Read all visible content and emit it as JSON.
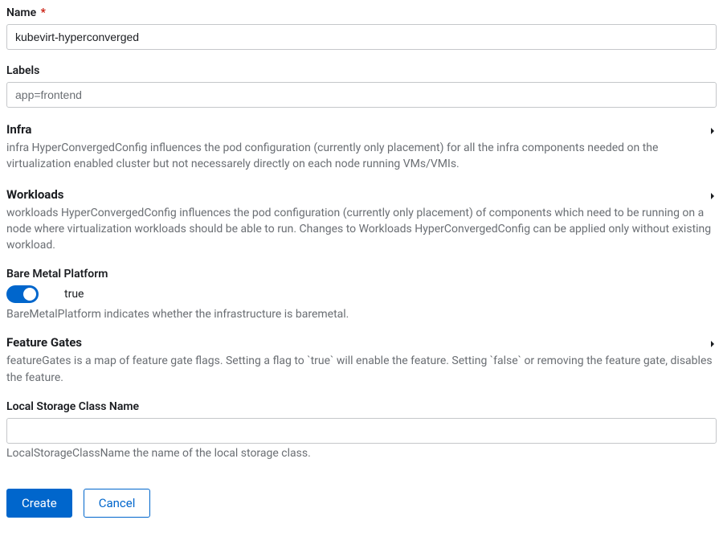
{
  "name": {
    "label": "Name",
    "value": "kubevirt-hyperconverged"
  },
  "labels": {
    "label": "Labels",
    "placeholder": "app=frontend",
    "value": ""
  },
  "sections": {
    "infra": {
      "title": "Infra",
      "desc": "infra HyperConvergedConfig influences the pod configuration (currently only placement) for all the infra components needed on the virtualization enabled cluster but not necessarely directly on each node running VMs/VMIs."
    },
    "workloads": {
      "title": "Workloads",
      "desc": "workloads HyperConvergedConfig influences the pod configuration (currently only placement) of components which need to be running on a node where virtualization workloads should be able to run. Changes to Workloads HyperConvergedConfig can be applied only without existing workload."
    },
    "bareMetal": {
      "title": "Bare Metal Platform",
      "toggleValue": "true",
      "desc": "BareMetalPlatform indicates whether the infrastructure is baremetal."
    },
    "featureGates": {
      "title": "Feature Gates",
      "desc": "featureGates is a map of feature gate flags. Setting a flag to `true` will enable the feature. Setting `false` or removing the feature gate, disables the feature."
    },
    "localStorage": {
      "title": "Local Storage Class Name",
      "value": "",
      "desc": "LocalStorageClassName the name of the local storage class."
    }
  },
  "buttons": {
    "create": "Create",
    "cancel": "Cancel"
  }
}
